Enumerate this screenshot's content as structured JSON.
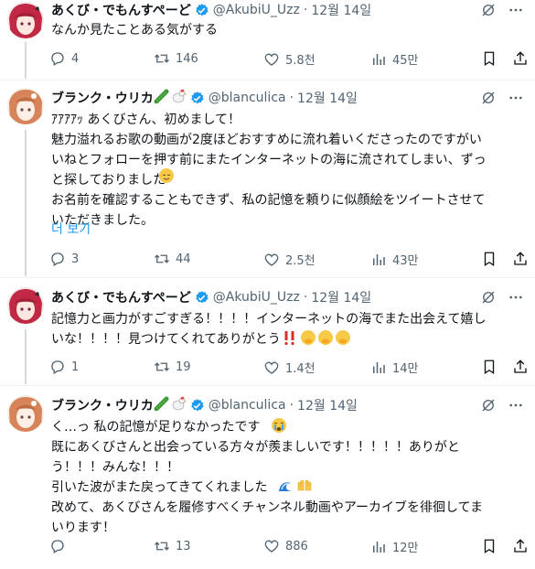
{
  "tweets": [
    {
      "name": "あくび・でもんすぺーど",
      "handle": "@AkubiU_Uzz",
      "separator": "·",
      "date": "12월 14일",
      "text": "なんか見たことある気がする",
      "reply_count": "4",
      "retweet_count": "146",
      "like_count": "5.8천",
      "view_count": "45만"
    },
    {
      "name": "ブランク・ウリカ",
      "handle": "@blanculica",
      "separator": "·",
      "date": "12월 14일",
      "text": "ｱｱｱｱｯ あくびさん、初めまして！\n魅力溢れるお歌の動画が2度ほどおすすめに流れ着いくださったのですがい\nいねとフォローを押す前にまたインターネットの海に流されてしまい、ずっ\nと探しておりました\nお名前を確認することもできず、私の記憶を頼りに似顔絵をツイートさせて\nいただきました。",
      "more": "더 보기",
      "reply_count": "3",
      "retweet_count": "44",
      "like_count": "2.5천",
      "view_count": "43만"
    },
    {
      "name": "あくび・でもんすぺーど",
      "handle": "@AkubiU_Uzz",
      "separator": "·",
      "date": "12월 14일",
      "text": "記憶力と画力がすごすぎる！！！！インターネットの海でまた出会えて嬉し\nいな！！！！見つけてくれてありがとう",
      "reply_count": "1",
      "retweet_count": "19",
      "like_count": "1.4천",
      "view_count": "14만"
    },
    {
      "name": "ブランク・ウリカ",
      "handle": "@blanculica",
      "separator": "·",
      "date": "12월 14일",
      "text": "く…っ 私の記憶が足りなかったです\n既にあくびさんと出会っている方々が羨ましいです！！！！！ありがと\nう！！！みんな！！！\n引いた波がまた戻ってきてくれました\n改めて、あくびさんを履修すべくチャンネル動画やアーカイブを徘徊してま\nいります！",
      "reply_count": "",
      "retweet_count": "13",
      "like_count": "886",
      "view_count": "12만"
    }
  ],
  "colors": {
    "text": "#0f1419",
    "secondary": "#536471",
    "link": "#1d9bf0",
    "verified": "#1d9bf0",
    "thread_line": "#cfd9de"
  },
  "icons": [
    "reply-icon",
    "retweet-icon",
    "like-icon",
    "views-icon",
    "bookmark-icon",
    "share-icon",
    "grok-icon",
    "more-icon",
    "verified-icon"
  ]
}
